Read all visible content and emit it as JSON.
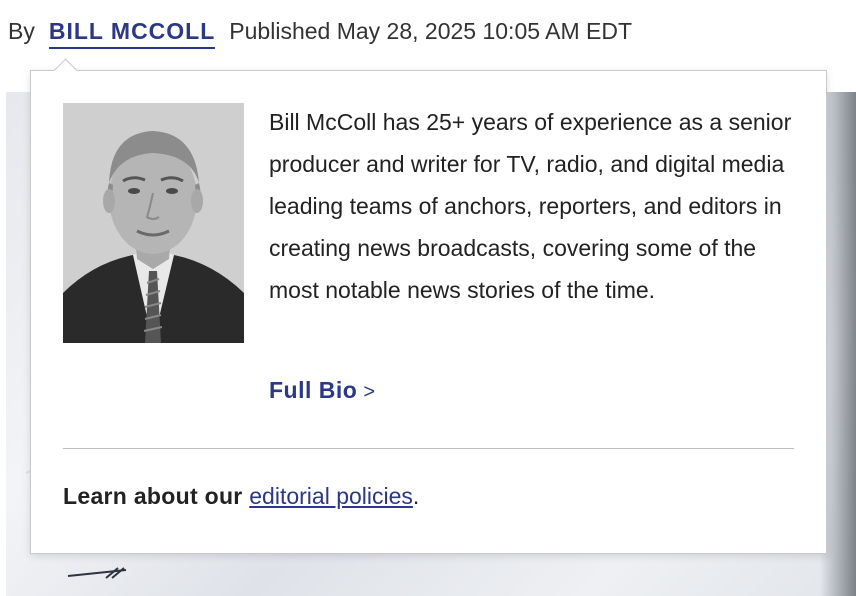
{
  "byline": {
    "by_label": "By",
    "author_name": "BILL MCCOLL",
    "published": "Published May 28, 2025 10:05 AM EDT"
  },
  "author_card": {
    "photo_icon": "author-headshot",
    "bio_text": "Bill McColl has 25+ years of experience as a senior producer and writer for TV, radio, and digital media leading teams of anchors, reporters, and editors in creating news broadcasts, covering some of the most notable news stories of the time.",
    "full_bio_label": "Full Bio",
    "full_bio_chevron": ">",
    "policy_prefix": "Learn about our",
    "policy_link_label": "editorial policies",
    "policy_suffix": "."
  },
  "colors": {
    "accent": "#2b3787",
    "text": "#222222",
    "divider": "#bdbdbd",
    "card_border": "#c9c9c9"
  }
}
